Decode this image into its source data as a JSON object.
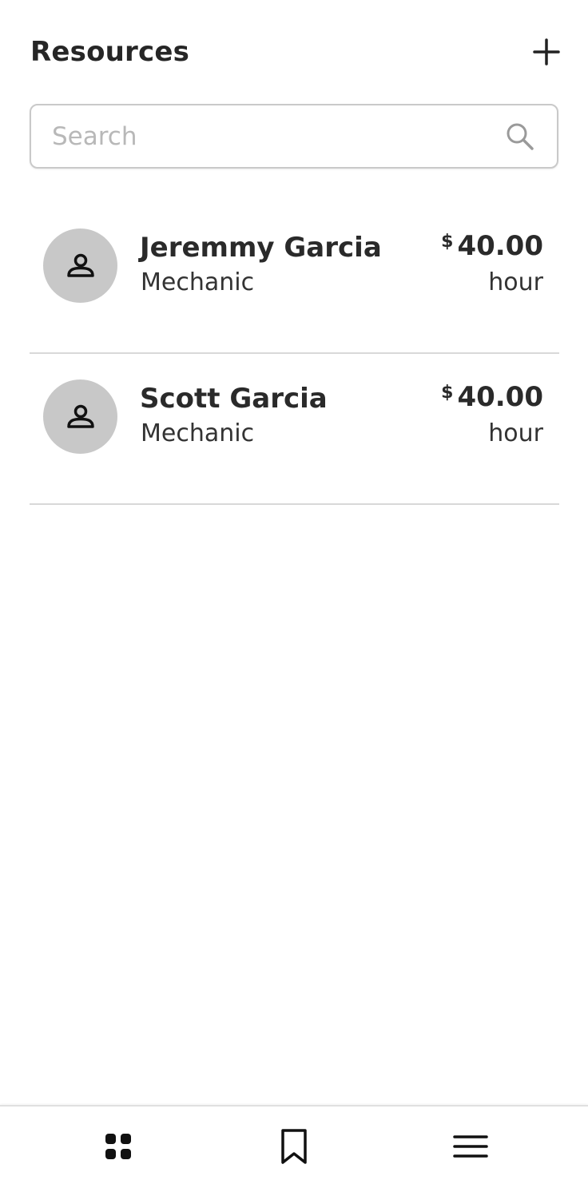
{
  "header": {
    "title": "Resources",
    "add_icon": "plus-icon"
  },
  "search": {
    "placeholder": "Search",
    "value": "",
    "icon": "search-icon"
  },
  "resources": [
    {
      "name": "Jeremmy Garcia",
      "role": "Mechanic",
      "currency": "$",
      "rate": "40.00",
      "unit": "hour",
      "avatar_icon": "person-icon"
    },
    {
      "name": "Scott Garcia",
      "role": "Mechanic",
      "currency": "$",
      "rate": "40.00",
      "unit": "hour",
      "avatar_icon": "person-icon"
    }
  ],
  "tabbar": {
    "tabs": [
      {
        "icon": "grid-icon"
      },
      {
        "icon": "bookmark-icon"
      },
      {
        "icon": "menu-icon"
      }
    ]
  },
  "colors": {
    "text": "#222222",
    "avatar_bg": "#c8c8c8",
    "border": "#c9c9c9",
    "divider": "#d8d8d8",
    "placeholder": "#b8b8b8"
  }
}
